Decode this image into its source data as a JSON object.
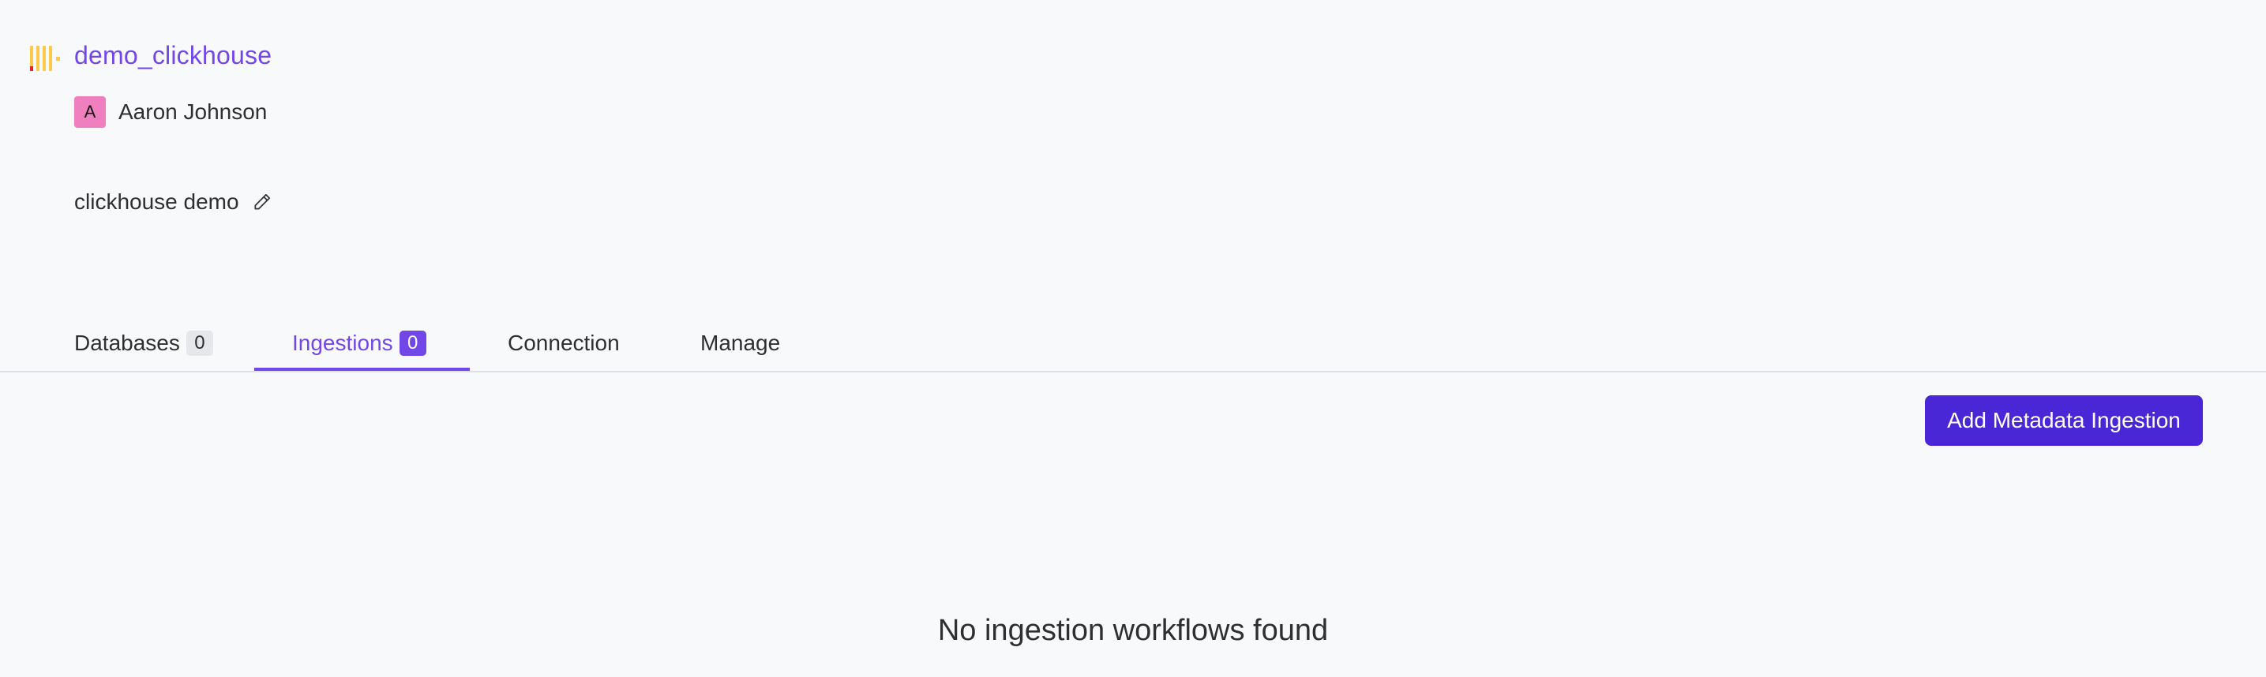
{
  "service": {
    "name": "demo_clickhouse",
    "logo_icon": "clickhouse-logo-icon"
  },
  "owner": {
    "avatar_letter": "A",
    "name": "Aaron Johnson",
    "avatar_color": "#ef7fbf"
  },
  "description": {
    "text": "clickhouse demo",
    "edit_icon": "pencil-icon"
  },
  "tabs": [
    {
      "label": "Databases",
      "count": "0"
    },
    {
      "label": "Ingestions",
      "count": "0",
      "active": true
    },
    {
      "label": "Connection"
    },
    {
      "label": "Manage"
    }
  ],
  "actions": {
    "add_ingestion_label": "Add Metadata Ingestion"
  },
  "empty_state": {
    "message": "No ingestion workflows found"
  },
  "colors": {
    "accent": "#7147e8",
    "primary_button": "#4a27d6",
    "background": "#f8f9fb"
  }
}
